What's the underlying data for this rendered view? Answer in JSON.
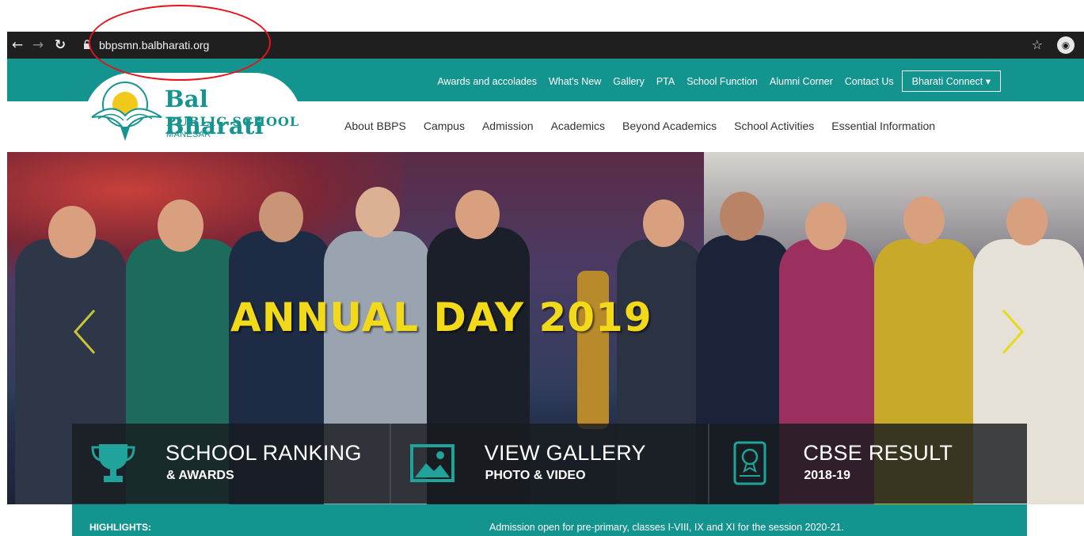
{
  "browser": {
    "url": "bbpsmn.balbharati.org",
    "icons": [
      "back-icon",
      "forward-icon",
      "reload-icon",
      "lock-icon",
      "star-icon",
      "incognito-icon"
    ]
  },
  "header": {
    "top_nav": [
      "Awards and accolades",
      "What's New",
      "Gallery",
      "PTA",
      "School Function",
      "Alumni Corner",
      "Contact Us"
    ],
    "connect_label": "Bharati Connect ▾",
    "main_nav": [
      "About BBPS",
      "Campus",
      "Admission",
      "Academics",
      "Beyond Academics",
      "School Activities",
      "Essential Information"
    ]
  },
  "logo": {
    "line1": "Bal Bharati",
    "line2": "PUBLIC SCHOOL",
    "line3": "MANESAR"
  },
  "hero": {
    "title": "ANNUAL DAY 2019"
  },
  "tiles": [
    {
      "title": "SCHOOL RANKING",
      "subtitle": "& AWARDS",
      "icon": "trophy-icon"
    },
    {
      "title": "VIEW GALLERY",
      "subtitle": "PHOTO & VIDEO",
      "icon": "image-icon"
    },
    {
      "title": "CBSE RESULT",
      "subtitle": "2018-19",
      "icon": "certificate-icon"
    }
  ],
  "highlights": {
    "label": "HIGHLIGHTS:",
    "text": "Admission open for pre-primary, classes I-VIII, IX and XI for the session 2020-21."
  },
  "colors": {
    "teal": "#14948f",
    "title_yellow": "#f2d91a",
    "annotation_red": "#e3141b"
  }
}
